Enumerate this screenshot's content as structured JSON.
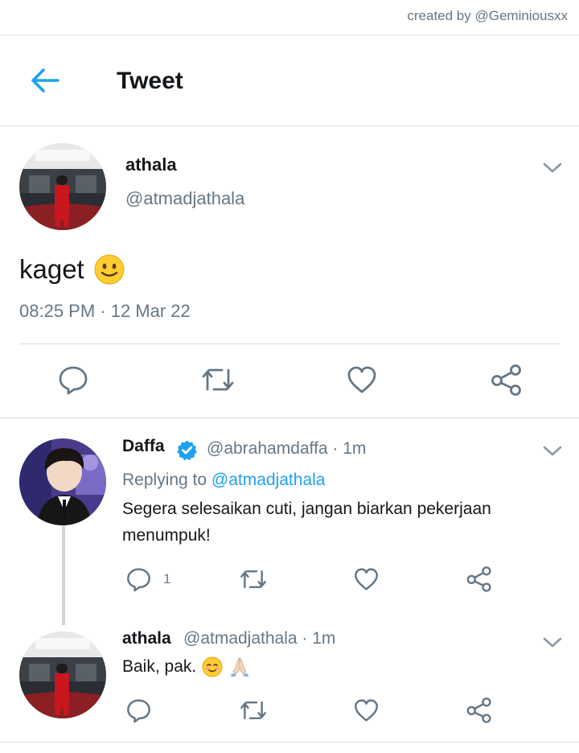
{
  "credit": "created by @Geminiousxx",
  "header": {
    "title": "Tweet",
    "back_icon": "arrow-left-icon"
  },
  "colors": {
    "accent": "#1da1f2",
    "muted": "#657786",
    "text": "#14171a",
    "divider": "#d8dde2"
  },
  "main_tweet": {
    "name": "athala",
    "handle": "@atmadjathala",
    "text": "kaget",
    "emoji": "slightly-smiling-face",
    "timestamp": "08:25 PM · 12 Mar 22",
    "actions": [
      "reply-icon",
      "retweet-icon",
      "like-icon",
      "share-icon"
    ]
  },
  "replies": [
    {
      "name": "Daffa",
      "verified": true,
      "handle_time": "@abrahamdaffa · 1m",
      "replying_label": "Replying to",
      "replying_to": "@atmadjathala",
      "text": "Segera selesaikan cuti, jangan biarkan pekerjaan menumpuk!",
      "reply_count": "1"
    },
    {
      "name": "athala",
      "handle_time": "@atmadjathala · 1m",
      "text": "Baik, pak.",
      "emojis": [
        "smiling-face-icon",
        "folded-hands-icon"
      ]
    }
  ]
}
